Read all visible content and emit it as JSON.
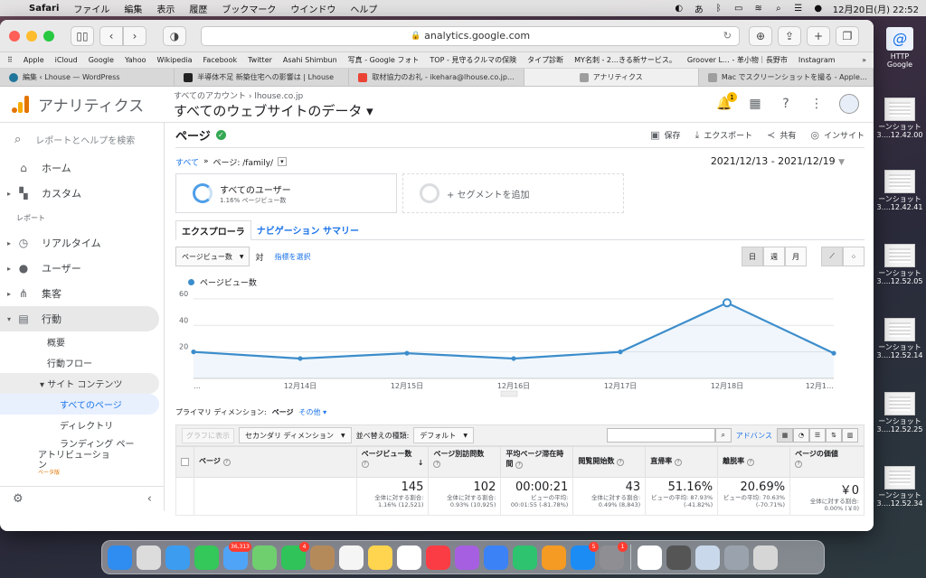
{
  "menubar": {
    "app": "Safari",
    "items": [
      "ファイル",
      "編集",
      "表示",
      "履歴",
      "ブックマーク",
      "ウインドウ",
      "ヘルプ"
    ],
    "datetime": "12月20日(月)  22:52"
  },
  "browser": {
    "url": "analytics.google.com",
    "bookmarks": [
      "Apple",
      "iCloud",
      "Google",
      "Yahoo",
      "Wikipedia",
      "Facebook",
      "Twitter",
      "Asahi Shimbun",
      "写真 - Google フォト",
      "TOP - 見守るクルマの保険",
      "タイプ診断",
      "MY名刺 - 2…きる新サービス。",
      "Groover L… - 革小物｜長野市",
      "Instagram"
    ],
    "tabs": [
      {
        "label": "編集 ‹ Lhouse — WordPress",
        "color": "#21759b"
      },
      {
        "label": "半導体不足 新築住宅への影響は | Lhouse",
        "color": "#222222"
      },
      {
        "label": "取材協力のお礼 - ikehara@lhouse.co.jp…",
        "color": "#ea4335"
      },
      {
        "label": "アナリティクス",
        "color": "#9e9e9e"
      },
      {
        "label": "Mac でスクリーンショットを撮る - Apple…",
        "color": "#9e9e9e"
      }
    ]
  },
  "ga": {
    "product": "アナリティクス",
    "account_crumb": "すべてのアカウント  ›  lhouse.co.jp",
    "view_name": "すべてのウェブサイトのデータ ▾",
    "notification_count": "1",
    "search_placeholder": "レポートとヘルプを検索",
    "nav": {
      "home": "ホーム",
      "custom": "カスタム",
      "reports_label": "レポート",
      "realtime": "リアルタイム",
      "users": "ユーザー",
      "acquisition": "集客",
      "behavior": "行動",
      "overview": "概要",
      "flow": "行動フロー",
      "site_content": "▾ サイト コンテンツ",
      "all_pages": "すべてのページ",
      "directory": "ディレクトリ",
      "landing": "ランディング ペー",
      "attribution": "アトリビューショ\nン",
      "beta": "ベータ版"
    },
    "report": {
      "title": "ページ",
      "save": "保存",
      "export": "エクスポート",
      "share": "共有",
      "insight": "インサイト",
      "crumb_all": "すべて",
      "crumb_sep": "»",
      "crumb_page": "ページ: /family/",
      "date_range": "2021/12/13 - 2021/12/19",
      "segment_name": "すべてのユーザー",
      "segment_sub": "1.16% ページビュー数",
      "add_segment": "+ セグメントを追加",
      "tab_explorer": "エクスプローラ",
      "tab_nav": "ナビゲーション サマリー",
      "metric_select": "ページビュー数",
      "vs": "対",
      "choose_metric": "指標を選択",
      "period_day": "日",
      "period_week": "週",
      "period_month": "月",
      "primary_dim_label": "プライマリ ディメンション:",
      "primary_dim_value": "ページ",
      "primary_dim_other": "その他 ▾",
      "plot_rows": "グラフに表示",
      "secondary_dim": "セカンダリ ディメンション",
      "sort_label": "並べ替えの種類:",
      "sort_value": "デフォルト",
      "advanced": "アドバンス"
    },
    "table": {
      "headers": [
        "ページ",
        "ページビュー数",
        "ページ別訪問数",
        "平均ページ滞在時間",
        "閲覧開始数",
        "直帰率",
        "離脱率",
        "ページの価値"
      ],
      "totals": [
        {
          "value": "145",
          "sub": "全体に対する割合: 1.16% (12,521)"
        },
        {
          "value": "102",
          "sub": "全体に対する割合: 0.93% (10,925)"
        },
        {
          "value": "00:00:21",
          "sub": "ビューの平均: 00:01:55 (-81.78%)"
        },
        {
          "value": "43",
          "sub": "全体に対する割合: 0.49% (8,843)"
        },
        {
          "value": "51.16%",
          "sub": "ビューの平均: 87.93% (-41.82%)"
        },
        {
          "value": "20.69%",
          "sub": "ビューの平均: 70.63% (-70.71%)"
        },
        {
          "value": "￥0",
          "sub": "全体に対する割合: 0.00% (￥0)"
        }
      ]
    }
  },
  "chart_data": {
    "type": "line",
    "series": [
      {
        "name": "ページビュー数",
        "values": [
          20,
          15,
          19,
          15,
          20,
          57,
          19
        ]
      }
    ],
    "x": [
      "…",
      "12月14日",
      "12月15日",
      "12月16日",
      "12月17日",
      "12月18日",
      "12月1…"
    ],
    "y_ticks": [
      20,
      40,
      60
    ],
    "ylim": [
      0,
      64
    ],
    "color": "#3c8dcc",
    "grid": true
  },
  "desktop": {
    "files": [
      {
        "name": "HTTP",
        "sub": "Google"
      },
      {
        "name": "ーンショット",
        "sub": "3....12.42.00"
      },
      {
        "name": "ーンショット",
        "sub": "3....12.42.41"
      },
      {
        "name": "ーンショット",
        "sub": "3....12.52.05"
      },
      {
        "name": "ーンショット",
        "sub": "3....12.52.14"
      },
      {
        "name": "ーンショット",
        "sub": "3....12.52.25"
      },
      {
        "name": "ーンショット",
        "sub": "3....12.52.34"
      }
    ]
  },
  "dock": {
    "apps": [
      {
        "name": "finder",
        "color": "#2f8cf0",
        "badge": ""
      },
      {
        "name": "launchpad",
        "color": "#dcdcdc",
        "badge": ""
      },
      {
        "name": "safari",
        "color": "#3c9cf0",
        "badge": ""
      },
      {
        "name": "messages",
        "color": "#34c759",
        "badge": ""
      },
      {
        "name": "mail",
        "color": "#4fa4f7",
        "badge": "36,313"
      },
      {
        "name": "maps",
        "color": "#6fcf6f",
        "badge": ""
      },
      {
        "name": "facetime",
        "color": "#30c35a",
        "badge": "4"
      },
      {
        "name": "contacts",
        "color": "#b58a5a",
        "badge": ""
      },
      {
        "name": "reminders",
        "color": "#f5f5f5",
        "badge": ""
      },
      {
        "name": "notes",
        "color": "#ffd54f",
        "badge": ""
      },
      {
        "name": "photos",
        "color": "#ffffff",
        "badge": ""
      },
      {
        "name": "music",
        "color": "#fc3c44",
        "badge": ""
      },
      {
        "name": "podcasts",
        "color": "#a65fe0",
        "badge": ""
      },
      {
        "name": "keynote",
        "color": "#3b82f6",
        "badge": ""
      },
      {
        "name": "numbers",
        "color": "#2ec36f",
        "badge": ""
      },
      {
        "name": "pages",
        "color": "#f59b23",
        "badge": ""
      },
      {
        "name": "app-store",
        "color": "#1c8cf5",
        "badge": "5"
      },
      {
        "name": "system-preferences",
        "color": "#8e8e93",
        "badge": "1"
      },
      {
        "name": "chrome",
        "color": "#ffffff",
        "badge": ""
      },
      {
        "name": "quicktime",
        "color": "#555555",
        "badge": ""
      },
      {
        "name": "preview",
        "color": "#c9d8ea",
        "badge": ""
      },
      {
        "name": "image-capture",
        "color": "#9aa3ad",
        "badge": ""
      },
      {
        "name": "trash",
        "color": "#d6d6d6",
        "badge": ""
      }
    ]
  }
}
